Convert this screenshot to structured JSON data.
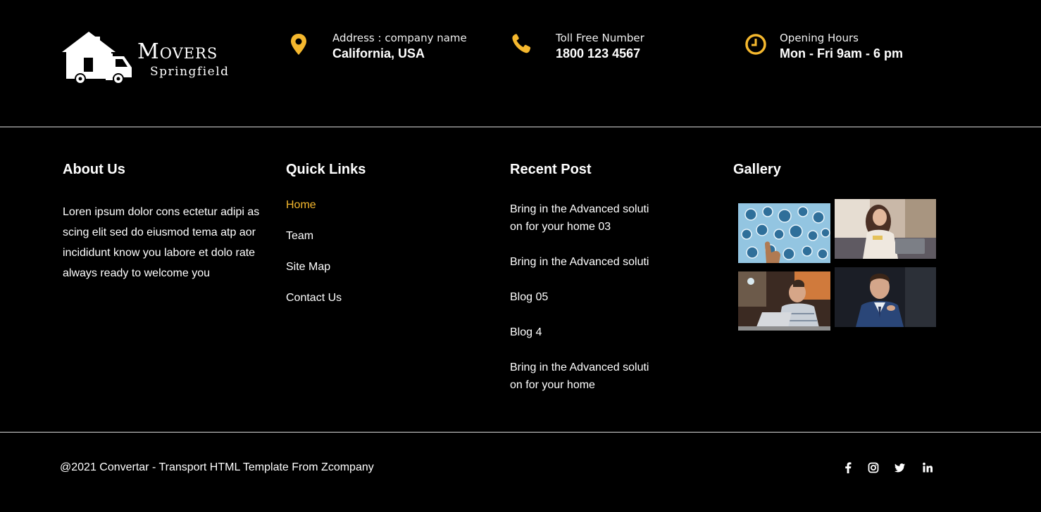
{
  "brand": {
    "name": "Movers",
    "tagline": "Springfield"
  },
  "contact": {
    "address_label": "Address : company name",
    "address_value": "California, USA",
    "phone_label": "Toll Free Number",
    "phone_value": "1800 123 4567",
    "hours_label": "Opening Hours",
    "hours_value": "Mon - Fri 9am - 6 pm"
  },
  "about": {
    "title": "About Us",
    "text": "Loren ipsum dolor cons ectetur adipi as scing elit sed do eiusmod tema atp aor incididunt know you labore et dolo rate always ready to welcome you"
  },
  "quick_links": {
    "title": "Quick Links",
    "items": [
      {
        "label": "Home"
      },
      {
        "label": "Team"
      },
      {
        "label": "Site Map"
      },
      {
        "label": "Contact Us"
      }
    ]
  },
  "recent_posts": {
    "title": "Recent Post",
    "items": [
      {
        "label": "Bring in the Advanced solution for your home 03"
      },
      {
        "label": "Bring in the Advanced soluti"
      },
      {
        "label": "Blog 05"
      },
      {
        "label": "Blog 4"
      },
      {
        "label": "Bring in the Advanced solution for your home"
      }
    ]
  },
  "gallery": {
    "title": "Gallery"
  },
  "footer": {
    "copyright": "@2021 Convertar - Transport HTML Template From Zcompany"
  },
  "social": [
    "facebook-icon",
    "instagram-icon",
    "twitter-icon",
    "linkedin-icon"
  ],
  "colors": {
    "background": "#000000",
    "accent": "#f5b82e",
    "text": "#ffffff",
    "divider": "#d8d8d8"
  }
}
